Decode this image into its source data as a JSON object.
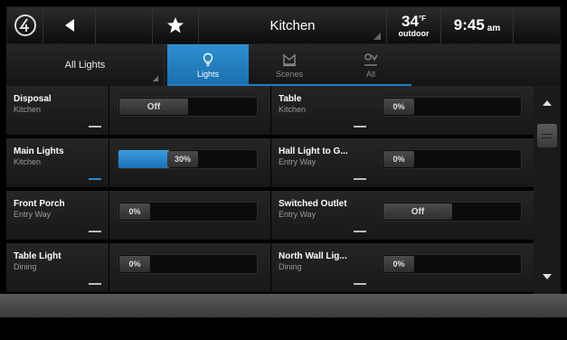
{
  "header": {
    "title": "Kitchen",
    "temperature": "34",
    "temp_unit": "F",
    "temp_label": "outdoor",
    "time": "9:45",
    "ampm": "am"
  },
  "nav": {
    "room_selector": "All Lights",
    "tabs": [
      {
        "label": "Lights",
        "active": true,
        "icon": "bulb-icon"
      },
      {
        "label": "Scenes",
        "active": false,
        "icon": "scenes-icon"
      },
      {
        "label": "All",
        "active": false,
        "icon": "all-icon"
      }
    ]
  },
  "devices": [
    {
      "name": "Disposal",
      "room": "Kitchen",
      "type": "switch",
      "state": "Off",
      "on": false
    },
    {
      "name": "Table",
      "room": "Kitchen",
      "type": "dimmer",
      "level": "0%",
      "level_value": 0,
      "on": false
    },
    {
      "name": "Main Lights",
      "room": "Kitchen",
      "type": "dimmer",
      "level": "30%",
      "level_value": 0.3,
      "on": true
    },
    {
      "name": "Hall Light to G...",
      "room": "Entry Way",
      "type": "dimmer",
      "level": "0%",
      "level_value": 0,
      "on": false
    },
    {
      "name": "Front Porch",
      "room": "Entry Way",
      "type": "dimmer",
      "level": "0%",
      "level_value": 0,
      "on": false
    },
    {
      "name": "Switched Outlet",
      "room": "Entry Way",
      "type": "switch",
      "state": "Off",
      "on": false
    },
    {
      "name": "Table Light",
      "room": "Dining",
      "type": "dimmer",
      "level": "0%",
      "level_value": 0,
      "on": false
    },
    {
      "name": "North Wall Lig...",
      "room": "Dining",
      "type": "dimmer",
      "level": "0%",
      "level_value": 0,
      "on": false
    }
  ],
  "colors": {
    "accent": "#1f7fc4"
  }
}
